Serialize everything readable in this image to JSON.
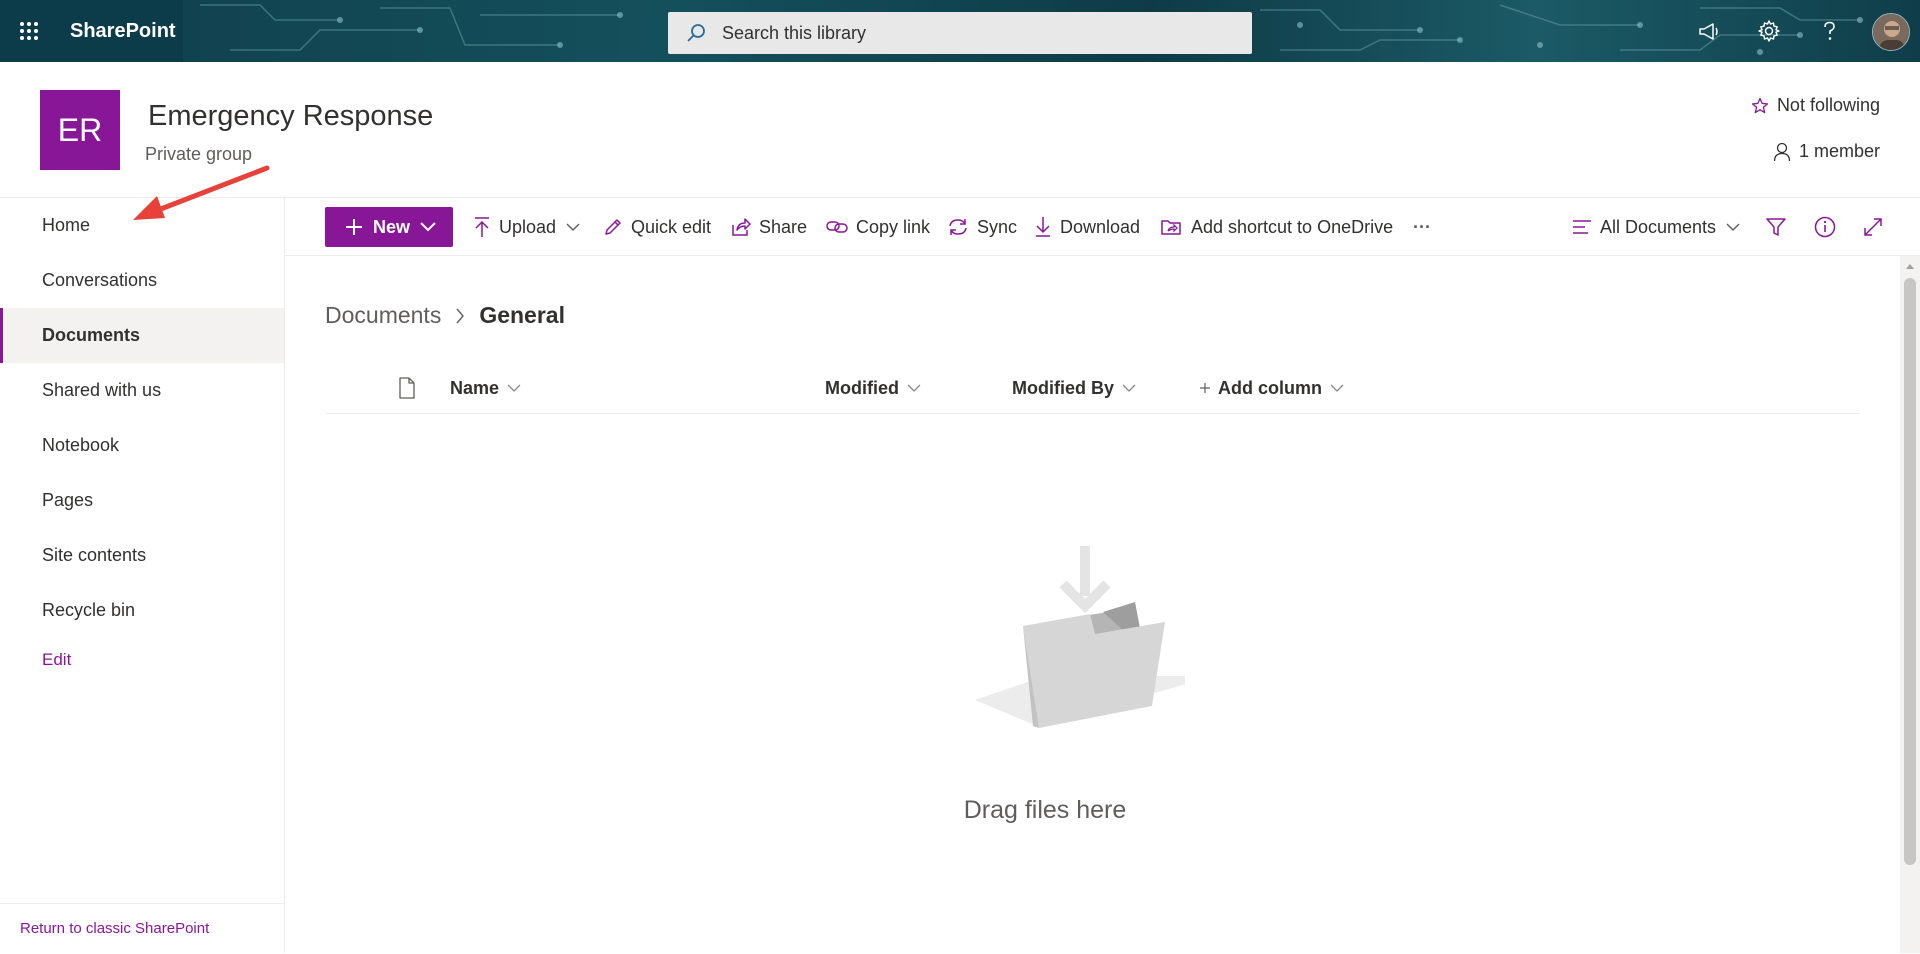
{
  "suitebar": {
    "brand": "SharePoint",
    "search_placeholder": "Search this library"
  },
  "site": {
    "logo_initials": "ER",
    "title": "Emergency Response",
    "subtitle": "Private group",
    "follow_label": "Not following",
    "members_label": "1 member"
  },
  "leftnav": {
    "items": [
      {
        "label": "Home"
      },
      {
        "label": "Conversations"
      },
      {
        "label": "Documents"
      },
      {
        "label": "Shared with us"
      },
      {
        "label": "Notebook"
      },
      {
        "label": "Pages"
      },
      {
        "label": "Site contents"
      },
      {
        "label": "Recycle bin"
      }
    ],
    "edit_label": "Edit",
    "classic_label": "Return to classic SharePoint"
  },
  "commandbar": {
    "new_label": "New",
    "upload_label": "Upload",
    "quick_edit_label": "Quick edit",
    "share_label": "Share",
    "copy_link_label": "Copy link",
    "sync_label": "Sync",
    "download_label": "Download",
    "add_shortcut_label": "Add shortcut to OneDrive",
    "more_label": "···",
    "view_label": "All Documents"
  },
  "breadcrumb": {
    "root": "Documents",
    "separator": ">",
    "current": "General"
  },
  "columns": {
    "name": "Name",
    "modified": "Modified",
    "modified_by": "Modified By",
    "add_column": "Add column"
  },
  "empty_state": {
    "text": "Drag files here"
  },
  "colors": {
    "accent": "#881798",
    "suitebar": "#0f3e4a"
  }
}
